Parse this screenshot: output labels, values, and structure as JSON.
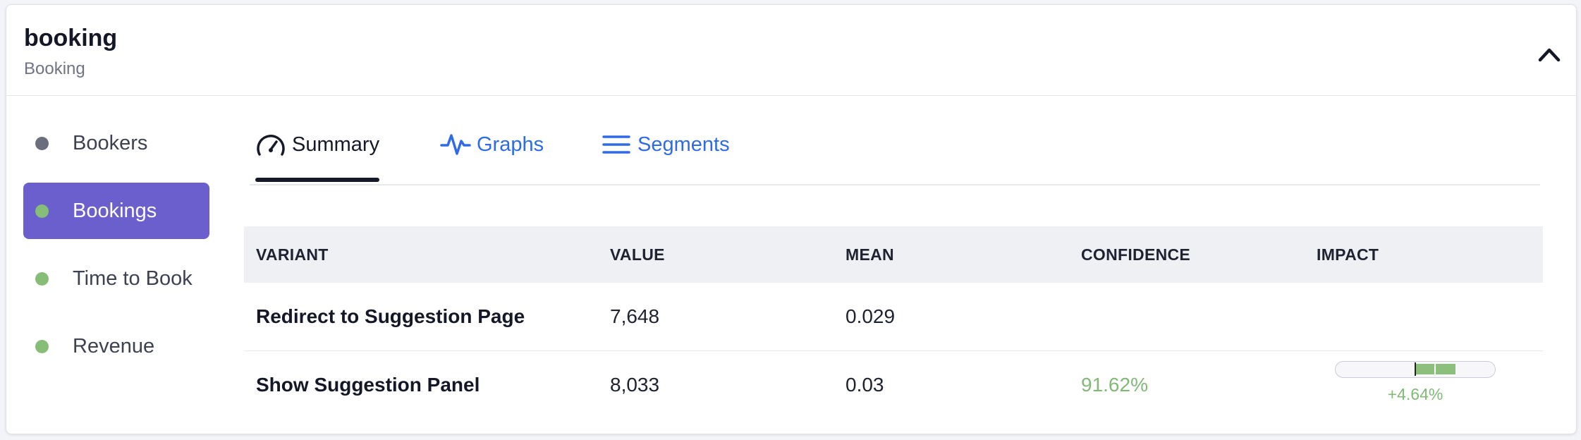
{
  "header": {
    "title": "booking",
    "subtitle": "Booking",
    "collapse_icon": "chevron-up-icon"
  },
  "sidebar": {
    "items": [
      {
        "label": "Bookers",
        "dot_color": "#6b6f7d",
        "active": false
      },
      {
        "label": "Bookings",
        "dot_color": "#86bd79",
        "active": true
      },
      {
        "label": "Time to Book",
        "dot_color": "#86bd79",
        "active": false
      },
      {
        "label": "Revenue",
        "dot_color": "#86bd79",
        "active": false
      }
    ]
  },
  "tabs": [
    {
      "label": "Summary",
      "icon": "gauge-icon",
      "active": true
    },
    {
      "label": "Graphs",
      "icon": "pulse-icon",
      "active": false
    },
    {
      "label": "Segments",
      "icon": "list-icon",
      "active": false
    }
  ],
  "table": {
    "columns": [
      "VARIANT",
      "VALUE",
      "MEAN",
      "CONFIDENCE",
      "IMPACT"
    ],
    "rows": [
      {
        "variant": "Redirect to Suggestion Page",
        "value": "7,648",
        "mean": "0.029",
        "confidence": "",
        "impact": ""
      },
      {
        "variant": "Show Suggestion Panel",
        "value": "8,033",
        "mean": "0.03",
        "confidence": "91.62%",
        "impact": "+4.64%"
      }
    ]
  },
  "colors": {
    "accent": "#6b5fcd",
    "link": "#2f6be6",
    "positive": "#82b878"
  }
}
